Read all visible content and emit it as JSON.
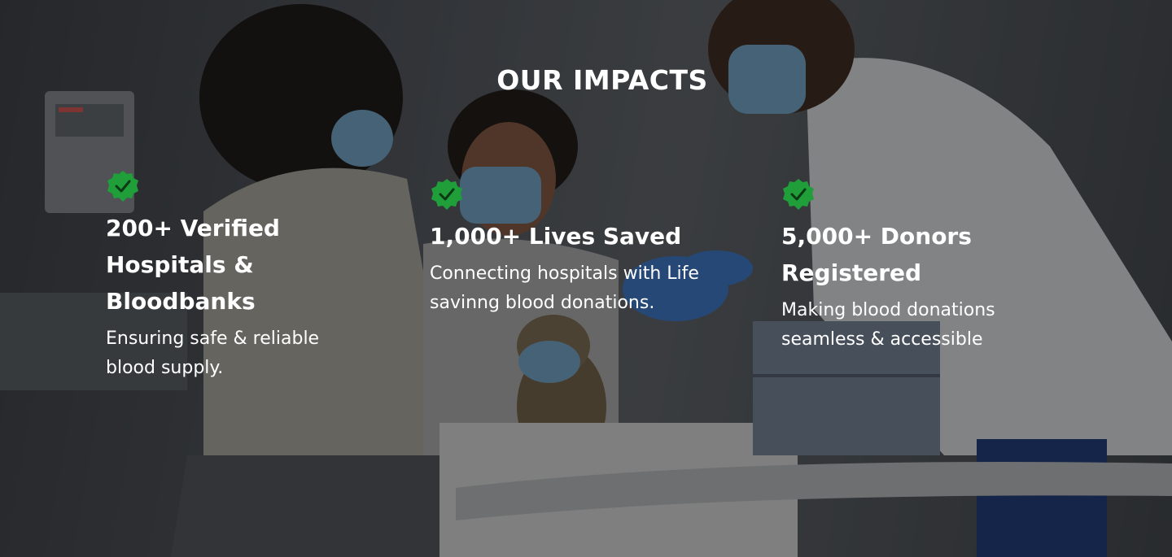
{
  "section": {
    "title": "OUR IMPACTS"
  },
  "stats": [
    {
      "heading": "200+ Verified Hospitals & Bloodbanks",
      "description": "Ensuring safe & reliable blood supply.",
      "icon": "verified-check-badge-icon"
    },
    {
      "heading": "1,000+ Lives Saved",
      "description": "Connecting hospitals with Life savinng blood donations.",
      "icon": "verified-check-badge-icon"
    },
    {
      "heading": "5,000+ Donors Registered",
      "description": "Making blood donations seamless & accessible",
      "icon": "verified-check-badge-icon"
    }
  ],
  "colors": {
    "badge_green": "#1f9e3a",
    "text": "#ffffff",
    "overlay": "#000000"
  }
}
